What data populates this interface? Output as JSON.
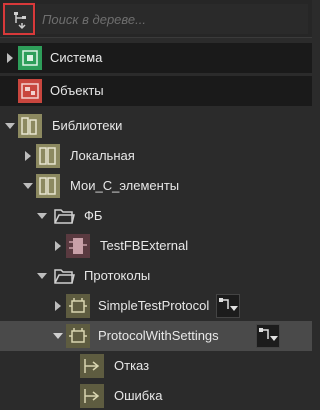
{
  "search": {
    "placeholder": "Поиск в дереве..."
  },
  "colors": {
    "accent_red": "#d8393a",
    "system_green": "#2e9e5a",
    "objects_red": "#c8463e",
    "library_olive": "#8c8960",
    "fb_pink": "#c9a0a8"
  },
  "tree": {
    "system": {
      "label": "Система",
      "icon": "system-icon"
    },
    "objects": {
      "label": "Объекты",
      "icon": "objects-icon"
    },
    "libraries": {
      "label": "Библиотеки",
      "icon": "libraries-icon"
    },
    "local": {
      "label": "Локальная",
      "icon": "library-icon"
    },
    "my_elements": {
      "label": "Мои_С_элементы",
      "icon": "library-icon"
    },
    "fb_folder": {
      "label": "ФБ",
      "icon": "folder-open-icon"
    },
    "test_fb": {
      "label": "TestFBExternal",
      "icon": "function-block-icon"
    },
    "protocols_folder": {
      "label": "Протоколы",
      "icon": "folder-open-icon"
    },
    "simple_protocol": {
      "label": "SimpleTestProtocol",
      "icon": "protocol-icon"
    },
    "protocol_settings": {
      "label": "ProtocolWithSettings",
      "icon": "protocol-icon"
    },
    "fail": {
      "label": "Отказ",
      "icon": "event-icon"
    },
    "error": {
      "label": "Ошибка",
      "icon": "event-icon"
    }
  }
}
